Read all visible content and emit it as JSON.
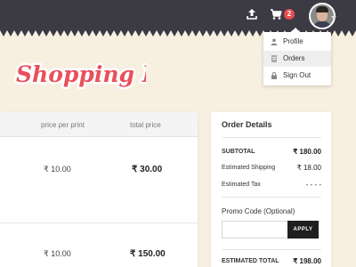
{
  "header": {
    "cart_badge_count": "2",
    "icons": [
      "upload-icon",
      "cart-icon",
      "avatar"
    ],
    "background_color": "#3c3a43"
  },
  "user_menu": {
    "items": [
      {
        "label": "Profile",
        "icon": "user-icon",
        "active": false
      },
      {
        "label": "Orders",
        "icon": "document-icon",
        "active": true
      },
      {
        "label": "Sign Out",
        "icon": "lock-icon",
        "active": false
      }
    ]
  },
  "logo": {
    "text": "Shopping Bag",
    "color": "#e8505b"
  },
  "cart": {
    "columns": [
      "price per print",
      "total price"
    ],
    "rows": [
      {
        "price_per_print": "₹ 10.00",
        "total_price": "₹ 30.00"
      },
      {
        "price_per_print": "₹ 10.00",
        "total_price": "₹ 150.00"
      }
    ]
  },
  "order_details": {
    "title": "Order Details",
    "subtotal_label": "SUBTOTAL",
    "subtotal_value": "₹ 180.00",
    "shipping_label": "Estimated Shipping",
    "shipping_value": "₹ 18.00",
    "tax_label": "Estimated Tax",
    "tax_value": "- - - -",
    "promo_label": "Promo Code (Optional)",
    "promo_placeholder": "",
    "apply_label": "APPLY",
    "total_label": "ESTIMATED TOTAL",
    "total_value": "₹ 198.00"
  }
}
